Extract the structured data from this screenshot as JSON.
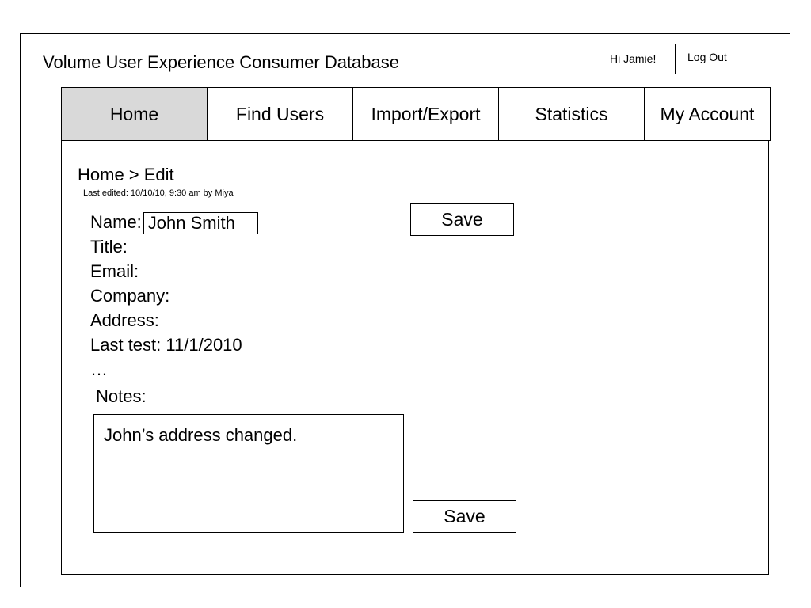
{
  "header": {
    "title": "Volume User Experience Consumer Database",
    "greeting": "Hi Jamie!",
    "logout_label": "Log Out"
  },
  "nav": {
    "tabs": [
      {
        "label": "Home",
        "active": true
      },
      {
        "label": "Find Users",
        "active": false
      },
      {
        "label": "Import/Export",
        "active": false
      },
      {
        "label": "Statistics",
        "active": false
      },
      {
        "label": "My Account",
        "active": false
      }
    ]
  },
  "page": {
    "breadcrumb": "Home > Edit",
    "last_edited": "Last edited: 10/10/10, 9:30 am by Miya"
  },
  "form": {
    "name_label": "Name:",
    "name_value": "John Smith",
    "title_label": "Title:",
    "email_label": "Email:",
    "company_label": "Company:",
    "address_label": "Address:",
    "last_test_label": "Last test:",
    "last_test_value": "11/1/2010",
    "more": "…",
    "notes_label": "Notes:",
    "notes_value": "John’s address changed.",
    "save_label": "Save"
  },
  "colors": {
    "active_tab": "#d9d9d9",
    "border": "#000000"
  }
}
